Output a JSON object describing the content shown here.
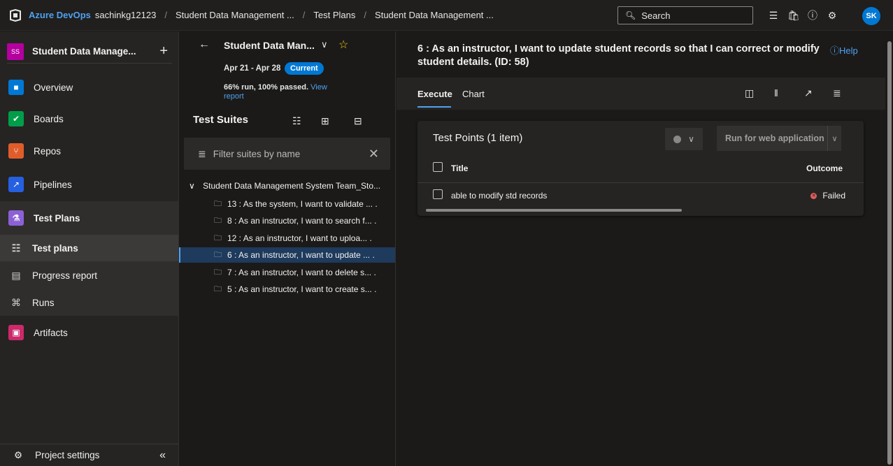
{
  "topbar": {
    "brand": "Azure DevOps",
    "org": "sachinkg12123",
    "crumbs": [
      "Student Data Management ...",
      "Test Plans",
      "Student Data Management ..."
    ],
    "search_placeholder": "Search",
    "avatar_initials": "SK"
  },
  "sidebar": {
    "project_badge": "SS",
    "project_name": "Student Data Manage...",
    "items": [
      {
        "label": "Overview",
        "icon": "overview-icon",
        "color": "#0078d4"
      },
      {
        "label": "Boards",
        "icon": "boards-icon",
        "color": "#009e49"
      },
      {
        "label": "Repos",
        "icon": "repos-icon",
        "color": "#e05d2b"
      },
      {
        "label": "Pipelines",
        "icon": "pipelines-icon",
        "color": "#2560e0"
      },
      {
        "label": "Test Plans",
        "icon": "test-plans-icon",
        "color": "#8c61d6"
      },
      {
        "label": "Test plans",
        "icon": "test-plans-sub-icon"
      },
      {
        "label": "Progress report",
        "icon": "progress-report-icon"
      },
      {
        "label": "Runs",
        "icon": "runs-icon"
      },
      {
        "label": "Artifacts",
        "icon": "artifacts-icon",
        "color": "#cc2a6a"
      }
    ],
    "settings_label": "Project settings"
  },
  "plan": {
    "title": "Student Data Man...",
    "dates": "Apr 21 - Apr 28",
    "current_badge": "Current",
    "run_summary": "66% run, 100% passed.",
    "view_report": "View report"
  },
  "suites": {
    "heading": "Test Suites",
    "filter_placeholder": "Filter suites by name",
    "root": "Student Data Management System Team_Sto...",
    "items": [
      "13 : As the system, I want to validate ... .",
      "8 : As an instructor, I want to search f... .",
      "12 : As an instructor, I want to uploa...  .",
      "6 : As an instructor, I want to update ... .",
      "7 : As an instructor, I want to delete s... .",
      "5 : As an instructor, I want to create s... ."
    ],
    "selected_index": 3
  },
  "main": {
    "title": "6 : As an instructor, I want to update student records so that I can correct or modify student details. (ID: 58)",
    "help": "Help",
    "tabs": [
      "Execute",
      "Chart"
    ],
    "test_points": {
      "heading": "Test Points (1 item)",
      "run_button": "Run for web application",
      "col_title": "Title",
      "col_outcome": "Outcome",
      "rows": [
        {
          "title": "able to modify std records",
          "outcome": "Failed"
        }
      ]
    }
  }
}
